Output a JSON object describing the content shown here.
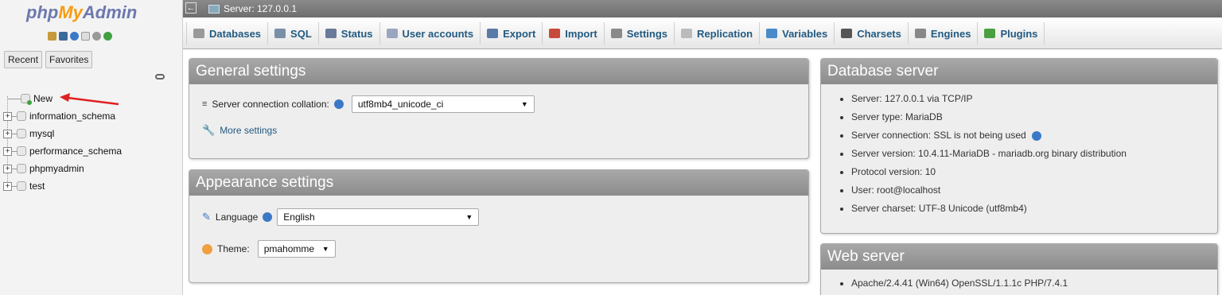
{
  "nav": {
    "logo": {
      "part1": "php",
      "part2": "My",
      "part3": "Admin"
    },
    "icons": [
      "home-icon",
      "database-icon",
      "help-icon",
      "docs-icon",
      "settings-icon",
      "reload-icon"
    ],
    "tabs": [
      "Recent",
      "Favorites"
    ],
    "tree": [
      {
        "name": "New",
        "expandable": false
      },
      {
        "name": "information_schema",
        "expandable": true
      },
      {
        "name": "mysql",
        "expandable": true
      },
      {
        "name": "performance_schema",
        "expandable": true
      },
      {
        "name": "phpmyadmin",
        "expandable": true
      },
      {
        "name": "test",
        "expandable": true
      }
    ]
  },
  "topbar": {
    "server": "Server: 127.0.0.1"
  },
  "menu": [
    {
      "label": "Databases",
      "icon": "databases-icon",
      "color": "#999999"
    },
    {
      "label": "SQL",
      "icon": "sql-icon",
      "color": "#7a8fa8"
    },
    {
      "label": "Status",
      "icon": "status-icon",
      "color": "#6a7a9a"
    },
    {
      "label": "User accounts",
      "icon": "users-icon",
      "color": "#9aa6c0"
    },
    {
      "label": "Export",
      "icon": "export-icon",
      "color": "#5a7aa8"
    },
    {
      "label": "Import",
      "icon": "import-icon",
      "color": "#c84a3a"
    },
    {
      "label": "Settings",
      "icon": "wrench-icon",
      "color": "#8a8a8a"
    },
    {
      "label": "Replication",
      "icon": "replication-icon",
      "color": "#bbbbbb"
    },
    {
      "label": "Variables",
      "icon": "variables-icon",
      "color": "#4a8ac8"
    },
    {
      "label": "Charsets",
      "icon": "charsets-icon",
      "color": "#555555"
    },
    {
      "label": "Engines",
      "icon": "engines-icon",
      "color": "#888888"
    },
    {
      "label": "Plugins",
      "icon": "plugins-icon",
      "color": "#4aa040"
    }
  ],
  "general": {
    "title": "General settings",
    "collation_label": "Server connection collation:",
    "collation_value": "utf8mb4_unicode_ci",
    "more_settings": "More settings"
  },
  "appearance": {
    "title": "Appearance settings",
    "language_label": "Language",
    "language_value": "English",
    "theme_label": "Theme:",
    "theme_value": "pmahomme"
  },
  "dbserver": {
    "title": "Database server",
    "items": [
      "Server: 127.0.0.1 via TCP/IP",
      "Server type: MariaDB",
      "Server connection: SSL is not being used",
      "Server version: 10.4.11-MariaDB - mariadb.org binary distribution",
      "Protocol version: 10",
      "User: root@localhost",
      "Server charset: UTF-8 Unicode (utf8mb4)"
    ]
  },
  "webserver": {
    "title": "Web server",
    "items": [
      "Apache/2.4.41 (Win64) OpenSSL/1.1.1c PHP/7.4.1"
    ]
  },
  "colors": {
    "accent": "#235a81",
    "logo_blue": "#6c78af",
    "logo_orange": "#f89c0e",
    "arrow": "#e02020"
  }
}
